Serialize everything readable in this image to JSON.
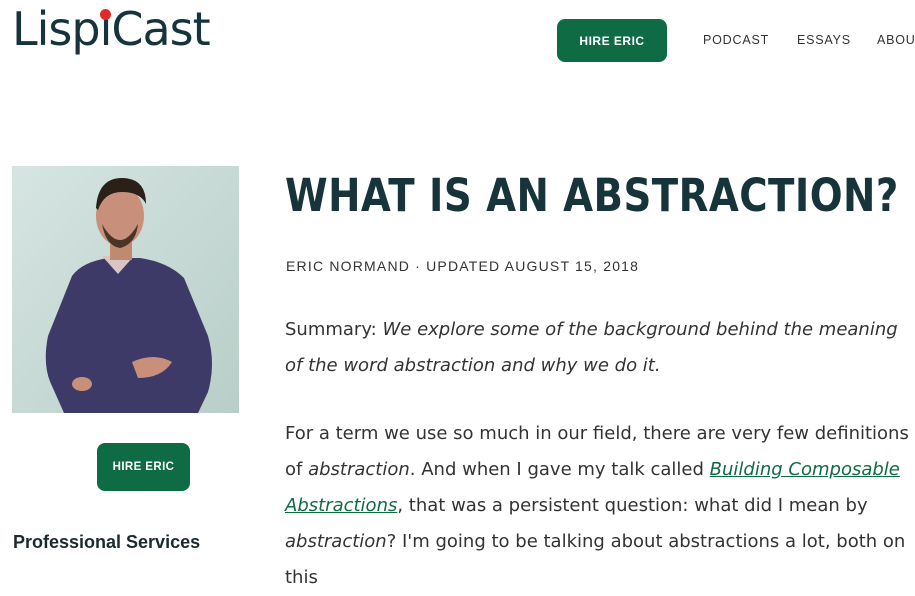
{
  "header": {
    "logo_pre": "Lisp",
    "logo_i": "ı",
    "logo_post": "Cast",
    "hire_button": "HIRE ERIC",
    "nav": [
      "PODCAST",
      "ESSAYS",
      "ABOUT"
    ]
  },
  "sidebar": {
    "hire_button": "HIRE ERIC",
    "section_title": "Professional Services"
  },
  "article": {
    "title": "WHAT IS AN ABSTRACTION?",
    "byline": "ERIC NORMAND · UPDATED AUGUST 15, 2018",
    "summary_label": "Summary: ",
    "summary_text": "We explore some of the background behind the meaning of the word abstraction and why we do it.",
    "p2_a": "For a term we use so much in our field, there are very few definitions of ",
    "p2_em1": "abstraction",
    "p2_b": ". And when I gave my talk called ",
    "p2_link": "Building Composable Abstractions",
    "p2_c": ", that was a persistent question: what did I mean by ",
    "p2_em2": "abstraction",
    "p2_d": "? I'm going to be talking about abstractions a lot, both on this"
  },
  "colors": {
    "brand_green": "#0f6b44",
    "logo_dot": "#e02b2b",
    "heading": "#16343a"
  }
}
